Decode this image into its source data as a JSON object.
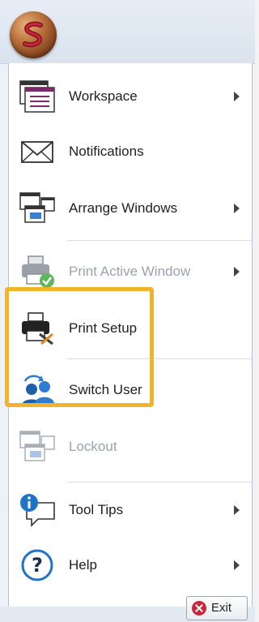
{
  "menu": {
    "items": [
      {
        "label": "Workspace",
        "icon": "workspace-icon",
        "submenu": true,
        "enabled": true
      },
      {
        "label": "Notifications",
        "icon": "envelope-icon",
        "submenu": false,
        "enabled": true
      },
      {
        "label": "Arrange Windows",
        "icon": "arrange-windows-icon",
        "submenu": true,
        "enabled": true
      },
      {
        "label": "Print Active Window",
        "icon": "printer-check-icon",
        "submenu": true,
        "enabled": false
      },
      {
        "label": "Print Setup",
        "icon": "printer-tools-icon",
        "submenu": false,
        "enabled": true
      },
      {
        "label": "Switch User",
        "icon": "switch-user-icon",
        "submenu": false,
        "enabled": true
      },
      {
        "label": "Lockout",
        "icon": "lockout-icon",
        "submenu": false,
        "enabled": false
      },
      {
        "label": "Tool Tips",
        "icon": "info-bubble-icon",
        "submenu": true,
        "enabled": true
      },
      {
        "label": "Help",
        "icon": "help-icon",
        "submenu": true,
        "enabled": true
      }
    ]
  },
  "footer": {
    "exit_label": "Exit"
  },
  "colors": {
    "highlight": "#f2b32d",
    "brand": "#b86f3a",
    "disabled_text": "#9aa3ad",
    "exit": "#c8283a"
  }
}
